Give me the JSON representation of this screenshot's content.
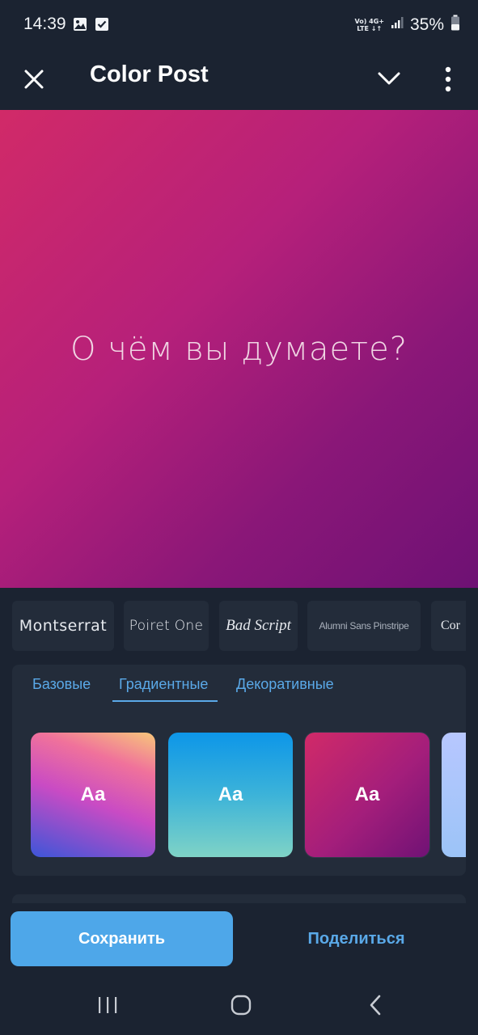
{
  "status_bar": {
    "time": "14:39",
    "network_top": "Vo) 4G+",
    "network_bottom": "LTE ↓↑",
    "battery_percent": "35%",
    "icons": [
      "gallery-icon",
      "checkbox-icon",
      "signal-icon",
      "battery-icon"
    ]
  },
  "app_bar": {
    "title": "Color Post",
    "icons": [
      "close-icon",
      "chevron-down-icon",
      "more-vertical-icon"
    ]
  },
  "canvas": {
    "text": "О чём вы думаете?",
    "gradient_colors": [
      "#d12a68",
      "#6e1174"
    ]
  },
  "fonts": [
    {
      "label": "Montserrat"
    },
    {
      "label": "Poiret One"
    },
    {
      "label": "Bad Script"
    },
    {
      "label": "Alumni Sans Pinstripe"
    },
    {
      "label": "Cor"
    }
  ],
  "style_tabs": {
    "items": [
      {
        "label": "Базовые"
      },
      {
        "label": "Градиентные"
      },
      {
        "label": "Декоративные"
      }
    ],
    "selected": "Градиентные"
  },
  "swatches": [
    {
      "label": "Aa"
    },
    {
      "label": "Aa"
    },
    {
      "label": "Aa"
    }
  ],
  "actions": {
    "save_label": "Сохранить",
    "share_label": "Поделиться"
  },
  "colors": {
    "background": "#1b2331",
    "panel": "#232c3a",
    "accent": "#5aa9e8",
    "save_button": "#4ea7e9"
  },
  "nav_bar": {
    "icons": [
      "recent-apps-icon",
      "home-icon",
      "back-icon"
    ]
  }
}
